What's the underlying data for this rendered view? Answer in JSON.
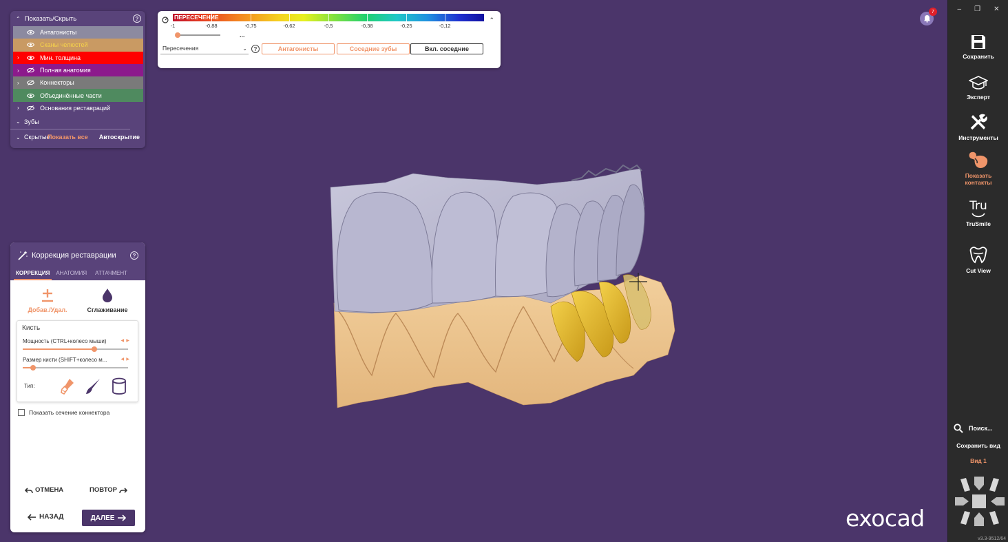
{
  "colors": {
    "background": "#4b356a",
    "panel_header": "#59437a",
    "accent": "#f0956a",
    "sidebar": "#2b2b2b",
    "layer_antagonists": "#8c8aa0",
    "layer_jaw_scans": "#c99a63",
    "layer_min_thickness": "#ff0000",
    "layer_full_anatomy": "#8c1a8c",
    "layer_connectors": "#7a7a7a",
    "layer_merged": "#4f8a5f"
  },
  "visibility_panel": {
    "title": "Показать/Скрыть",
    "layers": [
      {
        "label": "Антагонисты",
        "color": "#8c8aa0",
        "text_color": "#ffffff",
        "arrow": "",
        "eye": "visible"
      },
      {
        "label": "Сканы челюстей",
        "color": "#c99a63",
        "text_color": "#f6d34a",
        "arrow": "",
        "eye": "visible"
      },
      {
        "label": "Мин. толщина",
        "color": "#ff0000",
        "text_color": "#ffffff",
        "arrow": "›",
        "eye": "visible"
      },
      {
        "label": "Полная анатомия",
        "color": "#8c1a8c",
        "text_color": "#ffffff",
        "arrow": "›",
        "eye": "hidden"
      },
      {
        "label": "Коннекторы",
        "color": "#7a7a7a",
        "text_color": "#ffffff",
        "arrow": "›",
        "eye": "hidden"
      },
      {
        "label": "Объединённые части",
        "color": "#4f8a5f",
        "text_color": "#ffffff",
        "arrow": "",
        "eye": "visible"
      },
      {
        "label": "Основания реставраций",
        "color": "transparent",
        "text_color": "#ffffff",
        "arrow": "›",
        "eye": "hidden"
      }
    ],
    "teeth_section": "Зубы",
    "hidden_section": "Скрытые",
    "show_all": "Показать все",
    "autohide": "Автоскрытие"
  },
  "intersection_panel": {
    "scale_title": "ПЕРЕСЕЧЕНИЕ",
    "scale_labels": [
      "-1",
      "-0,88",
      "-0,75",
      "-0,62",
      "-0,5",
      "-0,38",
      "-0,25",
      "-0,12"
    ],
    "dots": "...",
    "mode_select": "Пересечения",
    "buttons": {
      "antagonists": "Антагонисты",
      "adjacent_teeth": "Соседние зубы",
      "include_adjacent": "Вкл. соседние"
    },
    "slider_value": 0
  },
  "correction_panel": {
    "title": "Коррекция реставрации",
    "tabs": [
      "КОРРЕКЦИЯ",
      "АНАТОМИЯ",
      "АТТАЧМЕНТ"
    ],
    "tools": {
      "add_remove": "Добав./Удал.",
      "smoothing": "Сглаживание"
    },
    "brush": {
      "title": "Кисть",
      "strength_label": "Мощность (CTRL+колесо мыши)",
      "strength_value": 0.68,
      "size_label": "Размер кисти (SHIFT+колесо м...",
      "size_value": 0.1,
      "type_label": "Тип:"
    },
    "show_connector_section": "Показать сечение коннектора",
    "undo": "ОТМЕНА",
    "redo": "ПОВТОР",
    "back": "НАЗАД",
    "next": "ДАЛЕЕ"
  },
  "notifications": {
    "count": "7"
  },
  "logo": "exocad",
  "sidebar": {
    "items": [
      {
        "label": "Сохранить",
        "icon": "save-icon"
      },
      {
        "label": "Эксперт",
        "icon": "graduation-cap-icon"
      },
      {
        "label": "Инструменты",
        "icon": "tools-icon"
      },
      {
        "label": "Показать контакты",
        "icon": "contacts-icon"
      },
      {
        "label": "TruSmile",
        "icon": "trusmile-icon"
      },
      {
        "label": "Cut View",
        "icon": "cut-view-icon"
      }
    ],
    "truesmile_glyph": "Tru",
    "search": "Поиск...",
    "save_view": "Сохранить вид",
    "view_1": "Вид 1",
    "version": "v3.3-9512/64"
  }
}
